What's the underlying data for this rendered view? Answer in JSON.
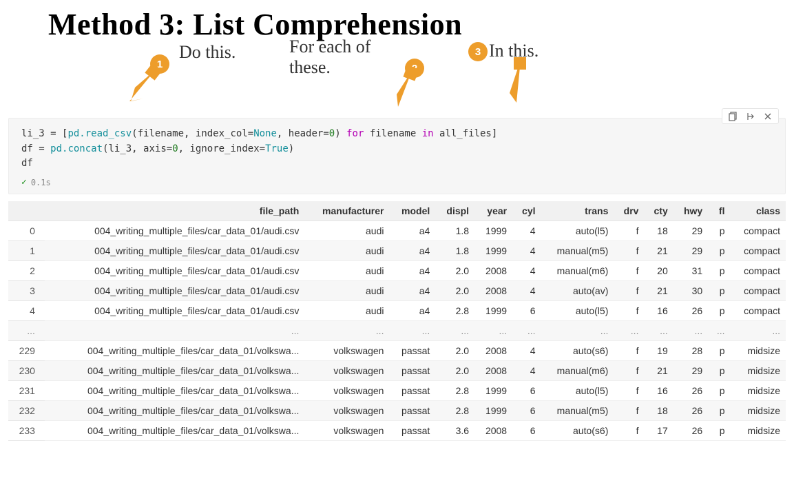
{
  "title": "Method 3: List Comprehension",
  "annotations": {
    "a1": {
      "label": "Do this.",
      "badge": "1"
    },
    "a2": {
      "label": "For each of\nthese.",
      "badge": "2"
    },
    "a3": {
      "label": "In this.",
      "badge": "3"
    }
  },
  "toolbar_icons": {
    "copy": "copy-icon",
    "run": "run-below-icon",
    "close": "close-icon"
  },
  "code": {
    "line1": {
      "var": "li_3",
      "eq": " = [",
      "fn": "pd.read_csv",
      "args_open": "(",
      "arg1": "filename",
      "arg_kw1": "index_col",
      "arg_val1": "None",
      "arg_kw2": "header",
      "arg_val2": "0",
      "args_close": ")",
      "kw_for": "for",
      "iter_var": "filename",
      "kw_in": "in",
      "iter_src": "all_files",
      "close": "]"
    },
    "line2": {
      "var": "df",
      "eq": " = ",
      "fn": "pd.concat",
      "args_open": "(",
      "arg1": "li_3",
      "arg_kw1": "axis",
      "arg_val1": "0",
      "arg_kw2": "ignore_index",
      "arg_val2": "True",
      "args_close": ")"
    },
    "line3": {
      "var": "df"
    },
    "exec_time": "0.1s"
  },
  "table": {
    "columns": [
      "file_path",
      "manufacturer",
      "model",
      "displ",
      "year",
      "cyl",
      "trans",
      "drv",
      "cty",
      "hwy",
      "fl",
      "class"
    ],
    "align": [
      "r",
      "r",
      "r",
      "r",
      "r",
      "r",
      "r",
      "r",
      "r",
      "r",
      "r",
      "r"
    ],
    "rows": [
      {
        "idx": "0",
        "cells": [
          "004_writing_multiple_files/car_data_01/audi.csv",
          "audi",
          "a4",
          "1.8",
          "1999",
          "4",
          "auto(l5)",
          "f",
          "18",
          "29",
          "p",
          "compact"
        ]
      },
      {
        "idx": "1",
        "cells": [
          "004_writing_multiple_files/car_data_01/audi.csv",
          "audi",
          "a4",
          "1.8",
          "1999",
          "4",
          "manual(m5)",
          "f",
          "21",
          "29",
          "p",
          "compact"
        ]
      },
      {
        "idx": "2",
        "cells": [
          "004_writing_multiple_files/car_data_01/audi.csv",
          "audi",
          "a4",
          "2.0",
          "2008",
          "4",
          "manual(m6)",
          "f",
          "20",
          "31",
          "p",
          "compact"
        ]
      },
      {
        "idx": "3",
        "cells": [
          "004_writing_multiple_files/car_data_01/audi.csv",
          "audi",
          "a4",
          "2.0",
          "2008",
          "4",
          "auto(av)",
          "f",
          "21",
          "30",
          "p",
          "compact"
        ]
      },
      {
        "idx": "4",
        "cells": [
          "004_writing_multiple_files/car_data_01/audi.csv",
          "audi",
          "a4",
          "2.8",
          "1999",
          "6",
          "auto(l5)",
          "f",
          "16",
          "26",
          "p",
          "compact"
        ]
      },
      {
        "idx": "...",
        "ellipsis": true,
        "cells": [
          "...",
          "...",
          "...",
          "...",
          "...",
          "...",
          "...",
          "...",
          "...",
          "...",
          "...",
          "..."
        ]
      },
      {
        "idx": "229",
        "cells": [
          "004_writing_multiple_files/car_data_01/volkswa...",
          "volkswagen",
          "passat",
          "2.0",
          "2008",
          "4",
          "auto(s6)",
          "f",
          "19",
          "28",
          "p",
          "midsize"
        ]
      },
      {
        "idx": "230",
        "cells": [
          "004_writing_multiple_files/car_data_01/volkswa...",
          "volkswagen",
          "passat",
          "2.0",
          "2008",
          "4",
          "manual(m6)",
          "f",
          "21",
          "29",
          "p",
          "midsize"
        ]
      },
      {
        "idx": "231",
        "cells": [
          "004_writing_multiple_files/car_data_01/volkswa...",
          "volkswagen",
          "passat",
          "2.8",
          "1999",
          "6",
          "auto(l5)",
          "f",
          "16",
          "26",
          "p",
          "midsize"
        ]
      },
      {
        "idx": "232",
        "cells": [
          "004_writing_multiple_files/car_data_01/volkswa...",
          "volkswagen",
          "passat",
          "2.8",
          "1999",
          "6",
          "manual(m5)",
          "f",
          "18",
          "26",
          "p",
          "midsize"
        ]
      },
      {
        "idx": "233",
        "cells": [
          "004_writing_multiple_files/car_data_01/volkswa...",
          "volkswagen",
          "passat",
          "3.6",
          "2008",
          "6",
          "auto(s6)",
          "f",
          "17",
          "26",
          "p",
          "midsize"
        ]
      }
    ]
  }
}
